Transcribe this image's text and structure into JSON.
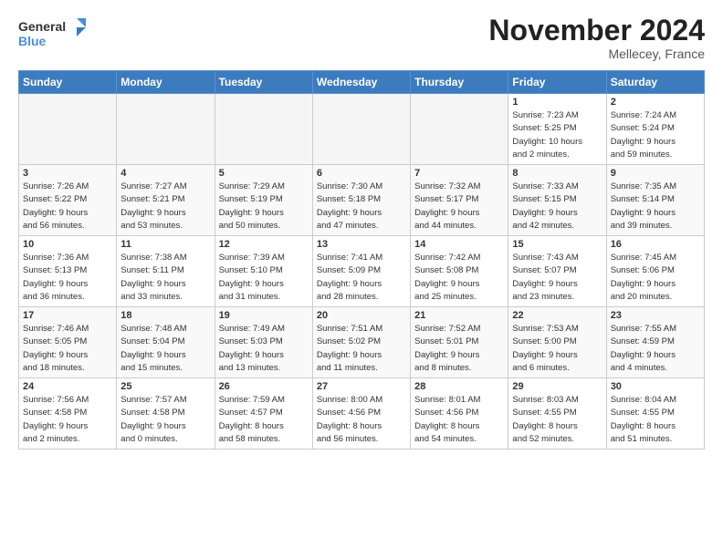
{
  "logo": {
    "line1": "General",
    "line2": "Blue"
  },
  "title": "November 2024",
  "location": "Mellecey, France",
  "headers": [
    "Sunday",
    "Monday",
    "Tuesday",
    "Wednesday",
    "Thursday",
    "Friday",
    "Saturday"
  ],
  "weeks": [
    [
      {
        "day": "",
        "info": ""
      },
      {
        "day": "",
        "info": ""
      },
      {
        "day": "",
        "info": ""
      },
      {
        "day": "",
        "info": ""
      },
      {
        "day": "",
        "info": ""
      },
      {
        "day": "1",
        "info": "Sunrise: 7:23 AM\nSunset: 5:25 PM\nDaylight: 10 hours\nand 2 minutes."
      },
      {
        "day": "2",
        "info": "Sunrise: 7:24 AM\nSunset: 5:24 PM\nDaylight: 9 hours\nand 59 minutes."
      }
    ],
    [
      {
        "day": "3",
        "info": "Sunrise: 7:26 AM\nSunset: 5:22 PM\nDaylight: 9 hours\nand 56 minutes."
      },
      {
        "day": "4",
        "info": "Sunrise: 7:27 AM\nSunset: 5:21 PM\nDaylight: 9 hours\nand 53 minutes."
      },
      {
        "day": "5",
        "info": "Sunrise: 7:29 AM\nSunset: 5:19 PM\nDaylight: 9 hours\nand 50 minutes."
      },
      {
        "day": "6",
        "info": "Sunrise: 7:30 AM\nSunset: 5:18 PM\nDaylight: 9 hours\nand 47 minutes."
      },
      {
        "day": "7",
        "info": "Sunrise: 7:32 AM\nSunset: 5:17 PM\nDaylight: 9 hours\nand 44 minutes."
      },
      {
        "day": "8",
        "info": "Sunrise: 7:33 AM\nSunset: 5:15 PM\nDaylight: 9 hours\nand 42 minutes."
      },
      {
        "day": "9",
        "info": "Sunrise: 7:35 AM\nSunset: 5:14 PM\nDaylight: 9 hours\nand 39 minutes."
      }
    ],
    [
      {
        "day": "10",
        "info": "Sunrise: 7:36 AM\nSunset: 5:13 PM\nDaylight: 9 hours\nand 36 minutes."
      },
      {
        "day": "11",
        "info": "Sunrise: 7:38 AM\nSunset: 5:11 PM\nDaylight: 9 hours\nand 33 minutes."
      },
      {
        "day": "12",
        "info": "Sunrise: 7:39 AM\nSunset: 5:10 PM\nDaylight: 9 hours\nand 31 minutes."
      },
      {
        "day": "13",
        "info": "Sunrise: 7:41 AM\nSunset: 5:09 PM\nDaylight: 9 hours\nand 28 minutes."
      },
      {
        "day": "14",
        "info": "Sunrise: 7:42 AM\nSunset: 5:08 PM\nDaylight: 9 hours\nand 25 minutes."
      },
      {
        "day": "15",
        "info": "Sunrise: 7:43 AM\nSunset: 5:07 PM\nDaylight: 9 hours\nand 23 minutes."
      },
      {
        "day": "16",
        "info": "Sunrise: 7:45 AM\nSunset: 5:06 PM\nDaylight: 9 hours\nand 20 minutes."
      }
    ],
    [
      {
        "day": "17",
        "info": "Sunrise: 7:46 AM\nSunset: 5:05 PM\nDaylight: 9 hours\nand 18 minutes."
      },
      {
        "day": "18",
        "info": "Sunrise: 7:48 AM\nSunset: 5:04 PM\nDaylight: 9 hours\nand 15 minutes."
      },
      {
        "day": "19",
        "info": "Sunrise: 7:49 AM\nSunset: 5:03 PM\nDaylight: 9 hours\nand 13 minutes."
      },
      {
        "day": "20",
        "info": "Sunrise: 7:51 AM\nSunset: 5:02 PM\nDaylight: 9 hours\nand 11 minutes."
      },
      {
        "day": "21",
        "info": "Sunrise: 7:52 AM\nSunset: 5:01 PM\nDaylight: 9 hours\nand 8 minutes."
      },
      {
        "day": "22",
        "info": "Sunrise: 7:53 AM\nSunset: 5:00 PM\nDaylight: 9 hours\nand 6 minutes."
      },
      {
        "day": "23",
        "info": "Sunrise: 7:55 AM\nSunset: 4:59 PM\nDaylight: 9 hours\nand 4 minutes."
      }
    ],
    [
      {
        "day": "24",
        "info": "Sunrise: 7:56 AM\nSunset: 4:58 PM\nDaylight: 9 hours\nand 2 minutes."
      },
      {
        "day": "25",
        "info": "Sunrise: 7:57 AM\nSunset: 4:58 PM\nDaylight: 9 hours\nand 0 minutes."
      },
      {
        "day": "26",
        "info": "Sunrise: 7:59 AM\nSunset: 4:57 PM\nDaylight: 8 hours\nand 58 minutes."
      },
      {
        "day": "27",
        "info": "Sunrise: 8:00 AM\nSunset: 4:56 PM\nDaylight: 8 hours\nand 56 minutes."
      },
      {
        "day": "28",
        "info": "Sunrise: 8:01 AM\nSunset: 4:56 PM\nDaylight: 8 hours\nand 54 minutes."
      },
      {
        "day": "29",
        "info": "Sunrise: 8:03 AM\nSunset: 4:55 PM\nDaylight: 8 hours\nand 52 minutes."
      },
      {
        "day": "30",
        "info": "Sunrise: 8:04 AM\nSunset: 4:55 PM\nDaylight: 8 hours\nand 51 minutes."
      }
    ]
  ]
}
